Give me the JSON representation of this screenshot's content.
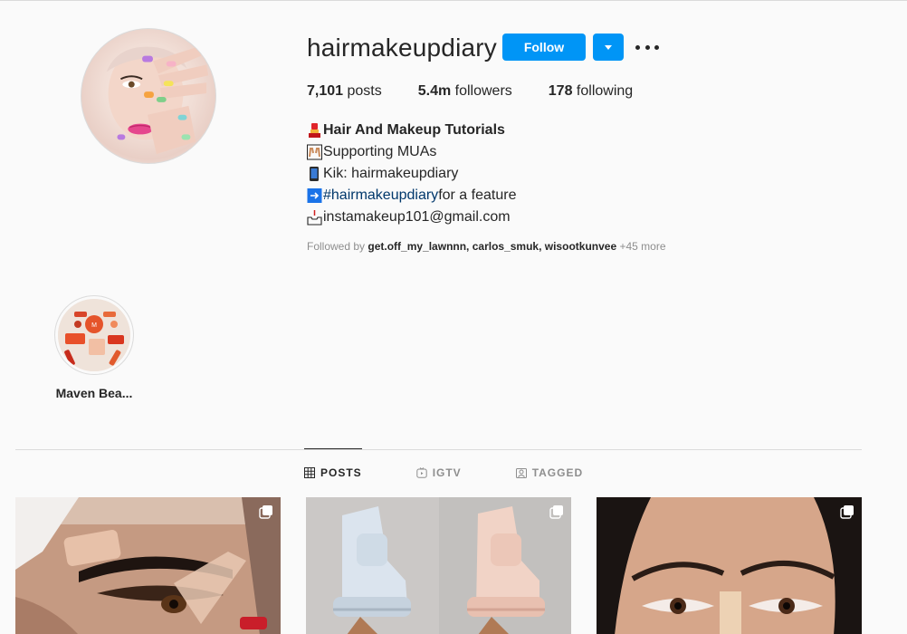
{
  "profile": {
    "username": "hairmakeupdiary",
    "follow_label": "Follow",
    "stats": [
      {
        "count": "7,101",
        "label": " posts"
      },
      {
        "count": "5.4m",
        "label": " followers"
      },
      {
        "count": "178",
        "label": " following"
      }
    ],
    "bio": {
      "name": "Hair And Makeup Tutorials",
      "line2": " Supporting MUAs",
      "line3": "Kik: hairmakeupdiary",
      "hashtag": "#hairmakeupdiary",
      "line4_rest": " for a feature",
      "line5": " instamakeup101@gmail.com"
    },
    "followed_by": {
      "prefix": "Followed by ",
      "names": "get.off_my_lawnnn, carlos_smuk, wisootkunvee",
      "more": " +45 more"
    }
  },
  "highlights": [
    {
      "label": "Maven Bea..."
    }
  ],
  "tabs": [
    {
      "label": "POSTS",
      "icon": "grid-icon",
      "active": true
    },
    {
      "label": "IGTV",
      "icon": "igtv-icon",
      "active": false
    },
    {
      "label": "TAGGED",
      "icon": "tagged-icon",
      "active": false
    }
  ],
  "posts": [
    {
      "type": "multiple",
      "icon": "carousel-icon"
    },
    {
      "type": "multiple",
      "icon": "carousel-icon"
    },
    {
      "type": "multiple",
      "icon": "carousel-icon"
    }
  ],
  "colors": {
    "accent": "#0095f6",
    "text": "#262626",
    "secondary": "#8e8e8e",
    "hashtag": "#00376b",
    "background": "#fafafa",
    "border": "#dbdbdb"
  }
}
